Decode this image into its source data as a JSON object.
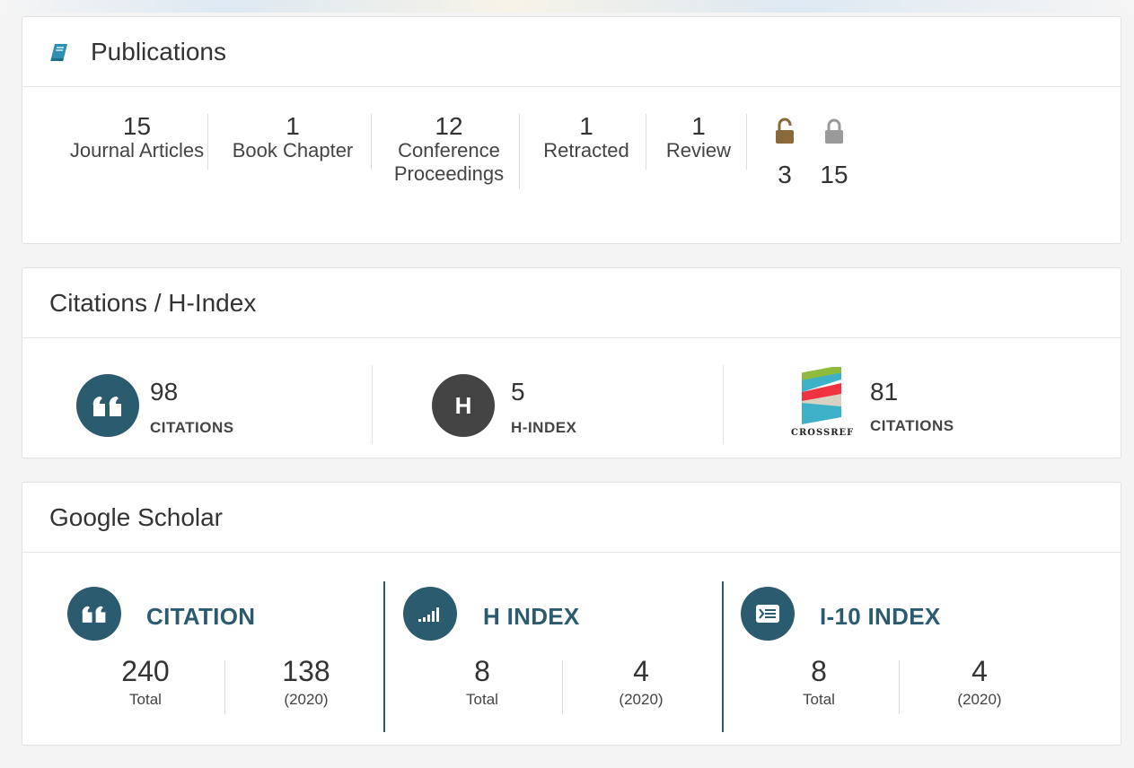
{
  "colors": {
    "accent": "#2b5b6e",
    "hindex_dark": "#444444",
    "lock_open": "#8a6a3a",
    "lock_closed": "#9a9a9a"
  },
  "publications": {
    "title": "Publications",
    "icon": "book-icon",
    "stats": [
      {
        "num": "15",
        "label": "Journal Articles"
      },
      {
        "num": "1",
        "label": "Book Chapter"
      },
      {
        "num": "12",
        "label_line1": "Conference",
        "label_line2": "Proceedings"
      },
      {
        "num": "1",
        "label": "Retracted"
      },
      {
        "num": "1",
        "label": "Review"
      }
    ],
    "open_access": {
      "icon": "lock-open-icon",
      "count": "3"
    },
    "closed_access": {
      "icon": "lock-closed-icon",
      "count": "15"
    }
  },
  "citations": {
    "title": "Citations / H-Index",
    "items": [
      {
        "icon": "quote-icon",
        "value": "98",
        "label": "CITATIONS"
      },
      {
        "icon": "h-icon",
        "icon_text": "H",
        "value": "5",
        "label": "H-INDEX"
      },
      {
        "icon": "crossref-logo",
        "logo_text": "CROSSREF",
        "value": "81",
        "label": "CITATIONS"
      }
    ]
  },
  "scholar": {
    "title": "Google Scholar",
    "sections": [
      {
        "icon": "quote-icon",
        "title": "CITATION",
        "total": "240",
        "total_label": "Total",
        "recent": "138",
        "recent_label": "(2020)"
      },
      {
        "icon": "signal-bars-icon",
        "title": "H INDEX",
        "total": "8",
        "total_label": "Total",
        "recent": "4",
        "recent_label": "(2020)"
      },
      {
        "icon": "index-list-icon",
        "title": "I-10 INDEX",
        "total": "8",
        "total_label": "Total",
        "recent": "4",
        "recent_label": "(2020)"
      }
    ]
  }
}
